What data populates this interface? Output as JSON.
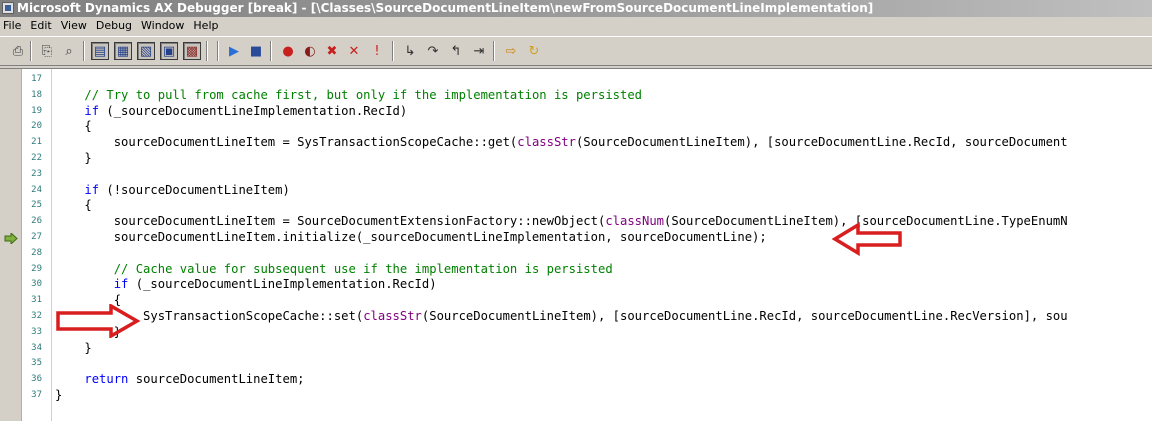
{
  "window": {
    "title": "Microsoft Dynamics AX Debugger [break] - [\\Classes\\SourceDocumentLineItem\\newFromSourceDocumentLineImplementation]"
  },
  "menu": [
    "File",
    "Edit",
    "View",
    "Debug",
    "Window",
    "Help"
  ],
  "toolbar": [
    {
      "icon": "print-icon"
    },
    {
      "icon": "copy-icon"
    },
    {
      "icon": "find-icon"
    },
    {
      "icon": "code-window-icon",
      "pressed": true
    },
    {
      "icon": "variables-window-icon",
      "pressed": true
    },
    {
      "icon": "callstack-window-icon",
      "pressed": true
    },
    {
      "icon": "watch-window-icon",
      "pressed": true
    },
    {
      "icon": "breakpoints-window-icon",
      "pressed": true
    },
    {
      "icon": "run-icon"
    },
    {
      "icon": "stop-icon"
    },
    {
      "icon": "toggle-breakpoint-icon"
    },
    {
      "icon": "enable-breakpoint-icon"
    },
    {
      "icon": "remove-breakpoint-icon"
    },
    {
      "icon": "remove-all-breakpoints-icon"
    },
    {
      "icon": "exclamation-icon"
    },
    {
      "icon": "step-into-icon"
    },
    {
      "icon": "step-over-icon"
    },
    {
      "icon": "step-out-icon"
    },
    {
      "icon": "run-to-cursor-icon"
    },
    {
      "icon": "show-next-statement-icon"
    },
    {
      "icon": "refresh-icon"
    }
  ],
  "colors": {
    "keyword": "#0000ff",
    "comment": "#008000",
    "marker": "#800080",
    "line_number": "#2e7a7a",
    "annotation_arrow": "#d81e1e",
    "exec_arrow": "#7fb040"
  },
  "current_line": "27",
  "code_lines": [
    {
      "n": "17",
      "segs": [
        {
          "t": ""
        }
      ]
    },
    {
      "n": "18",
      "segs": [
        {
          "t": "    "
        },
        {
          "t": "// Try to pull from cache first, but only if the implementation is persisted",
          "c": "cm"
        }
      ]
    },
    {
      "n": "19",
      "segs": [
        {
          "t": "    "
        },
        {
          "t": "if",
          "c": "kw"
        },
        {
          "t": " (_sourceDocumentLineImplementation.RecId)"
        }
      ]
    },
    {
      "n": "20",
      "segs": [
        {
          "t": "    {"
        }
      ]
    },
    {
      "n": "21",
      "segs": [
        {
          "t": "        sourceDocumentLineItem = SysTransactionScopeCache::get("
        },
        {
          "t": "classStr",
          "c": "mk"
        },
        {
          "t": "(SourceDocumentLineItem), [sourceDocumentLine.RecId, sourceDocument"
        }
      ]
    },
    {
      "n": "22",
      "segs": [
        {
          "t": "    }"
        }
      ]
    },
    {
      "n": "23",
      "segs": [
        {
          "t": ""
        }
      ]
    },
    {
      "n": "24",
      "segs": [
        {
          "t": "    "
        },
        {
          "t": "if",
          "c": "kw"
        },
        {
          "t": " (!sourceDocumentLineItem)"
        }
      ]
    },
    {
      "n": "25",
      "segs": [
        {
          "t": "    {"
        }
      ]
    },
    {
      "n": "26",
      "segs": [
        {
          "t": "        sourceDocumentLineItem = SourceDocumentExtensionFactory::newObject("
        },
        {
          "t": "classNum",
          "c": "mk"
        },
        {
          "t": "(SourceDocumentLineItem), [sourceDocumentLine.TypeEnumN"
        }
      ]
    },
    {
      "n": "27",
      "segs": [
        {
          "t": "        sourceDocumentLineItem.initialize(_sourceDocumentLineImplementation, sourceDocumentLine);"
        }
      ]
    },
    {
      "n": "28",
      "segs": [
        {
          "t": ""
        }
      ]
    },
    {
      "n": "29",
      "segs": [
        {
          "t": "        "
        },
        {
          "t": "// Cache value for subsequent use if the implementation is persisted",
          "c": "cm"
        }
      ]
    },
    {
      "n": "30",
      "segs": [
        {
          "t": "        "
        },
        {
          "t": "if",
          "c": "kw"
        },
        {
          "t": " (_sourceDocumentLineImplementation.RecId)"
        }
      ]
    },
    {
      "n": "31",
      "segs": [
        {
          "t": "        {"
        }
      ]
    },
    {
      "n": "32",
      "segs": [
        {
          "t": "            SysTransactionScopeCache::set("
        },
        {
          "t": "classStr",
          "c": "mk"
        },
        {
          "t": "(SourceDocumentLineItem), [sourceDocumentLine.RecId, sourceDocumentLine.RecVersion], sou"
        }
      ]
    },
    {
      "n": "33",
      "segs": [
        {
          "t": "        }"
        }
      ]
    },
    {
      "n": "34",
      "segs": [
        {
          "t": "    }"
        }
      ]
    },
    {
      "n": "35",
      "segs": [
        {
          "t": ""
        }
      ]
    },
    {
      "n": "36",
      "segs": [
        {
          "t": "    "
        },
        {
          "t": "return",
          "c": "kw"
        },
        {
          "t": " sourceDocumentLineItem;"
        }
      ]
    },
    {
      "n": "37",
      "segs": [
        {
          "t": "}"
        }
      ]
    }
  ]
}
